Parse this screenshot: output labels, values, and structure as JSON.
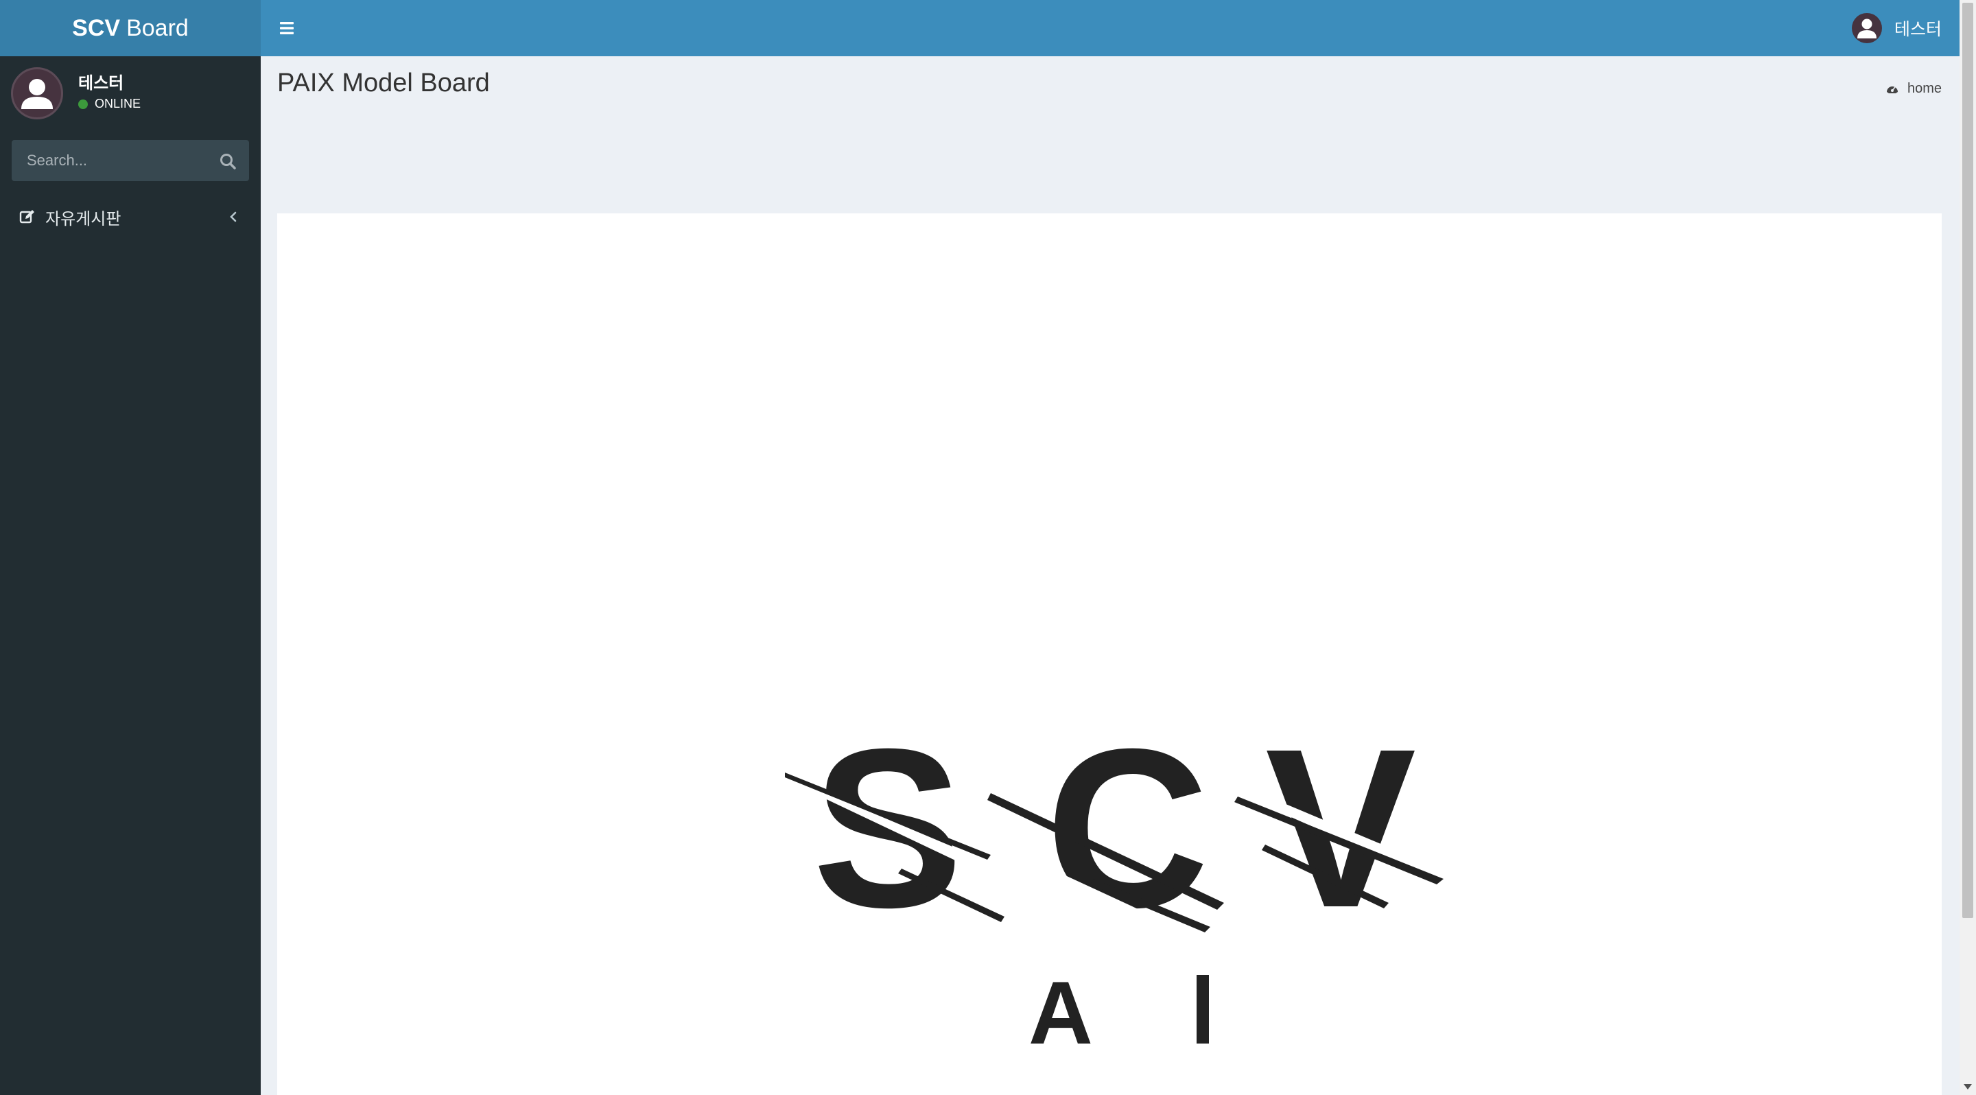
{
  "brand": {
    "bold": "SCV",
    "light": "Board"
  },
  "user": {
    "name": "테스터",
    "status": "ONLINE",
    "status_color": "#3c9a3c"
  },
  "search": {
    "placeholder": "Search..."
  },
  "menu": {
    "items": [
      {
        "label": "자유게시판",
        "icon": "edit-icon"
      }
    ]
  },
  "header": {
    "title": "PAIX Model Board",
    "breadcrumb": "home"
  },
  "logo": {
    "text": "SCV",
    "subtext": "A I"
  },
  "colors": {
    "navbar": "#3c8dbc",
    "brand": "#367fa9",
    "sidebar": "#222d32",
    "background": "#ecf0f5"
  }
}
